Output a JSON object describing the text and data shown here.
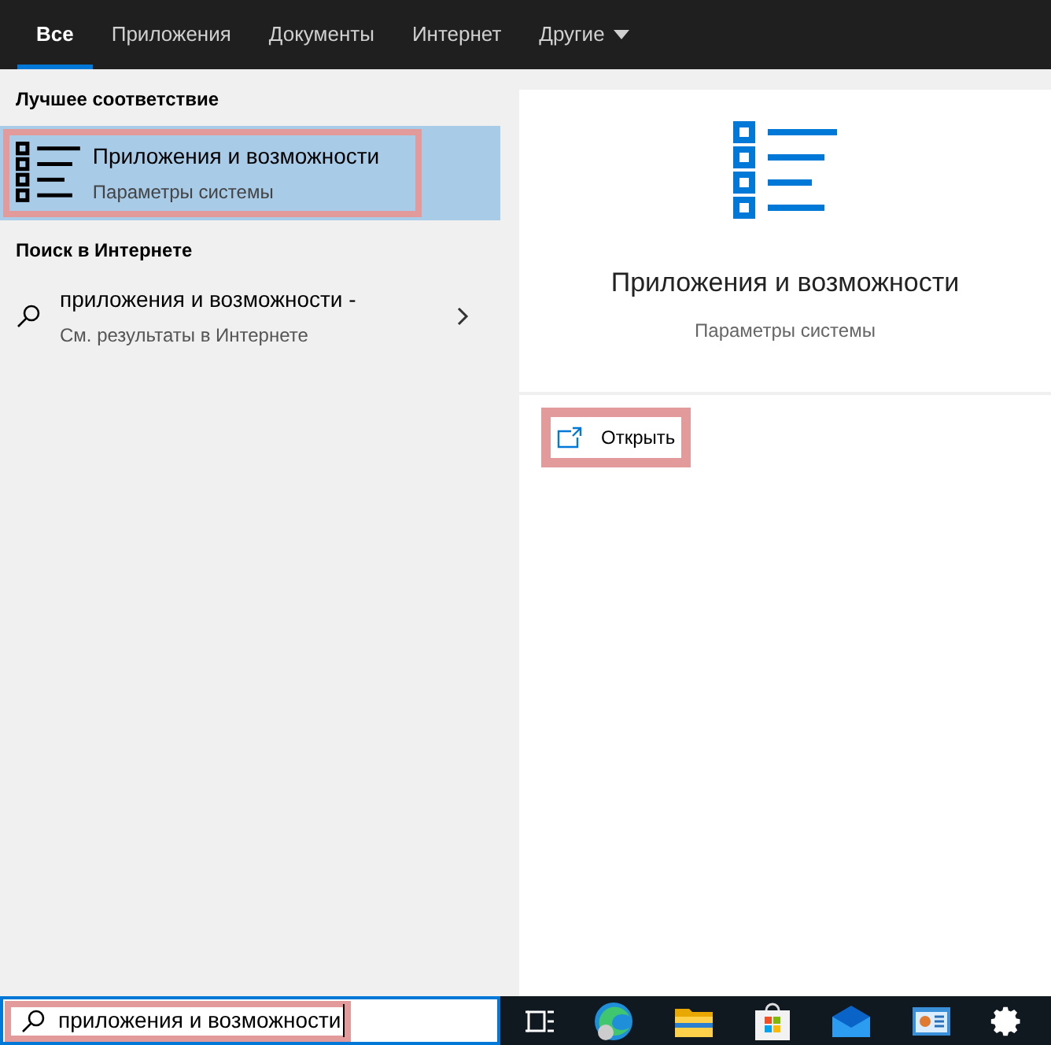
{
  "tabs": [
    {
      "label": "Все",
      "selected": true
    },
    {
      "label": "Приложения",
      "selected": false
    },
    {
      "label": "Документы",
      "selected": false
    },
    {
      "label": "Интернет",
      "selected": false
    },
    {
      "label": "Другие",
      "selected": false,
      "kind": "dropdown"
    }
  ],
  "best_match": {
    "heading": "Лучшее соответствие",
    "title": "Приложения и возможности",
    "subtitle": "Параметры системы",
    "selected": true,
    "highlighted": true
  },
  "web_search": {
    "heading": "Поиск в Интернете",
    "title": "приложения и возможности -",
    "subtitle": "См. результаты в Интернете"
  },
  "preview": {
    "title": "Приложения и возможности",
    "subtitle": "Параметры системы",
    "actions": [
      {
        "label": "Открыть",
        "highlighted": true
      }
    ]
  },
  "search_box": {
    "value": "приложения и возможности",
    "highlighted": true
  },
  "taskbar": [
    {
      "kind": "taskview"
    },
    {
      "kind": "edge"
    },
    {
      "kind": "explorer"
    },
    {
      "kind": "store"
    },
    {
      "kind": "mail"
    },
    {
      "kind": "app"
    },
    {
      "kind": "settings"
    }
  ]
}
